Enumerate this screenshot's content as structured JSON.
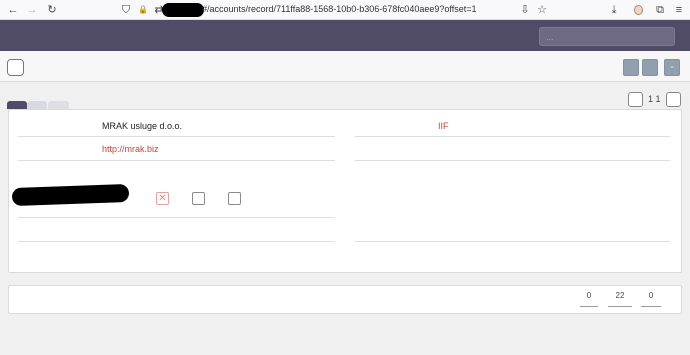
{
  "browser": {
    "url": "#/accounts/record/711ffa88-1568-10b0-b306-678fc040aee9?offset=1",
    "back_glyph": "←",
    "forward_glyph": "→",
    "reload_glyph": "↻",
    "shield_glyph": "⛉",
    "lock_glyph": "🔒",
    "permissions_glyph": "⇄",
    "reader_glyph": "⇩",
    "star_glyph": "☆",
    "download_glyph": "⤓",
    "extensions_glyph": "⧉",
    "menu_glyph": "≡"
  },
  "header": {
    "search_placeholder": "..."
  },
  "toolbar": {
    "minus_label": "-"
  },
  "pager": {
    "count": "1 1"
  },
  "record": {
    "company_name": "MRAK usluge d.o.o.",
    "website": "http://mrak.biz",
    "type": "IIF",
    "checkbox_marks": [
      "✕",
      "",
      ""
    ]
  },
  "footer": {
    "values": [
      "0",
      "22",
      "0"
    ]
  },
  "colors": {
    "header_bg": "#504b67",
    "link_red": "#c1443a",
    "button_gray": "#929fae"
  }
}
